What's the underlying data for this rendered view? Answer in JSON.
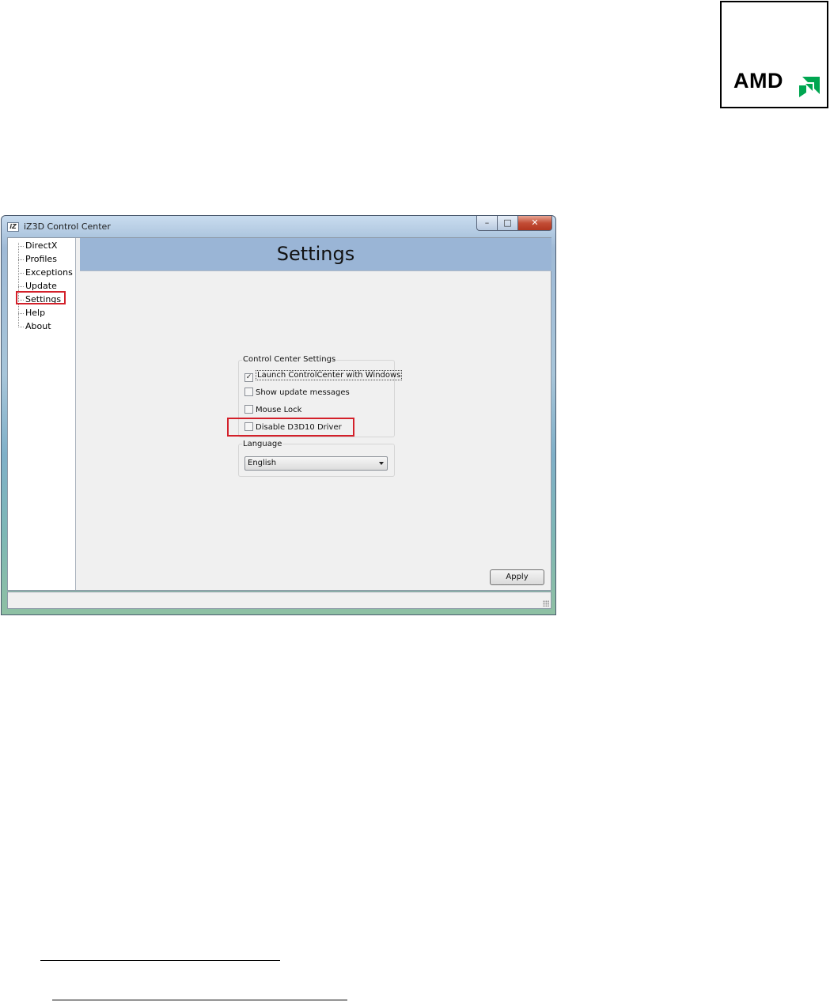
{
  "logo": {
    "text": "AMD",
    "color": "#00a651"
  },
  "window": {
    "title": "iZ3D Control Center",
    "buttons": {
      "minimize": "–",
      "maximize": "□",
      "close": "✕"
    }
  },
  "tree": {
    "items": [
      "DirectX",
      "Profiles",
      "Exceptions",
      "Update",
      "Settings",
      "Help",
      "About"
    ],
    "selected": "Settings"
  },
  "page": {
    "title": "Settings"
  },
  "control_center": {
    "label": "Control Center Settings",
    "options": [
      {
        "label": "Launch ControlCenter with Windows",
        "checked": true
      },
      {
        "label": "Show update messages",
        "checked": false
      },
      {
        "label": "Mouse Lock",
        "checked": false
      },
      {
        "label": "Disable D3D10 Driver",
        "checked": false
      }
    ]
  },
  "language": {
    "label": "Language",
    "value": "English"
  },
  "apply_label": "Apply",
  "highlight_color": "#d3202a"
}
